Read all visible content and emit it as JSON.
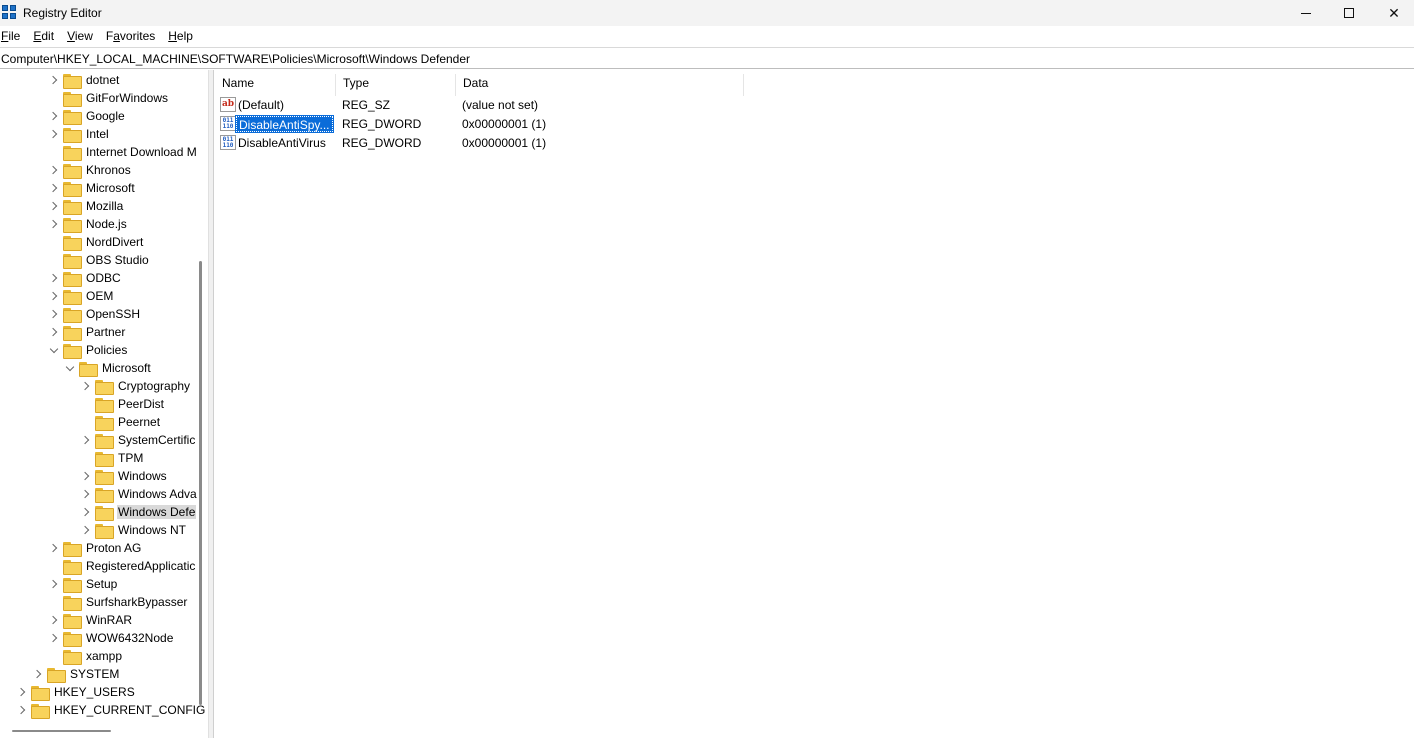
{
  "window": {
    "title": "Registry Editor",
    "controls": {
      "minimize": "",
      "maximize": "",
      "close": "✕"
    }
  },
  "menu": [
    "File",
    "Edit",
    "View",
    "Favorites",
    "Help"
  ],
  "address": "Computer\\HKEY_LOCAL_MACHINE\\SOFTWARE\\Policies\\Microsoft\\Windows Defender",
  "tree": [
    {
      "label": "dotnet",
      "expander": "right",
      "level": 3
    },
    {
      "label": "GitForWindows",
      "expander": "none",
      "level": 3
    },
    {
      "label": "Google",
      "expander": "right",
      "level": 3
    },
    {
      "label": "Intel",
      "expander": "right",
      "level": 3
    },
    {
      "label": "Internet Download M",
      "expander": "none",
      "level": 3
    },
    {
      "label": "Khronos",
      "expander": "right",
      "level": 3
    },
    {
      "label": "Microsoft",
      "expander": "right",
      "level": 3
    },
    {
      "label": "Mozilla",
      "expander": "right",
      "level": 3
    },
    {
      "label": "Node.js",
      "expander": "right",
      "level": 3
    },
    {
      "label": "NordDivert",
      "expander": "none",
      "level": 3
    },
    {
      "label": "OBS Studio",
      "expander": "none",
      "level": 3
    },
    {
      "label": "ODBC",
      "expander": "right",
      "level": 3
    },
    {
      "label": "OEM",
      "expander": "right",
      "level": 3
    },
    {
      "label": "OpenSSH",
      "expander": "right",
      "level": 3
    },
    {
      "label": "Partner",
      "expander": "right",
      "level": 3
    },
    {
      "label": "Policies",
      "expander": "down",
      "level": 3
    },
    {
      "label": "Microsoft",
      "expander": "down",
      "level": 4
    },
    {
      "label": "Cryptography",
      "expander": "right",
      "level": 5
    },
    {
      "label": "PeerDist",
      "expander": "none",
      "level": 5
    },
    {
      "label": "Peernet",
      "expander": "none",
      "level": 5
    },
    {
      "label": "SystemCertific",
      "expander": "right",
      "level": 5
    },
    {
      "label": "TPM",
      "expander": "none",
      "level": 5
    },
    {
      "label": "Windows",
      "expander": "right",
      "level": 5
    },
    {
      "label": "Windows Adva",
      "expander": "right",
      "level": 5
    },
    {
      "label": "Windows Defe",
      "expander": "right",
      "level": 5,
      "selected": true
    },
    {
      "label": "Windows NT",
      "expander": "right",
      "level": 5
    },
    {
      "label": "Proton AG",
      "expander": "right",
      "level": 3
    },
    {
      "label": "RegisteredApplicatic",
      "expander": "none",
      "level": 3
    },
    {
      "label": "Setup",
      "expander": "right",
      "level": 3
    },
    {
      "label": "SurfsharkBypasser",
      "expander": "none",
      "level": 3
    },
    {
      "label": "WinRAR",
      "expander": "right",
      "level": 3
    },
    {
      "label": "WOW6432Node",
      "expander": "right",
      "level": 3
    },
    {
      "label": "xampp",
      "expander": "none",
      "level": 3
    },
    {
      "label": "SYSTEM",
      "expander": "right",
      "level": 2
    },
    {
      "label": "HKEY_USERS",
      "expander": "right",
      "level": 1
    },
    {
      "label": "HKEY_CURRENT_CONFIG",
      "expander": "right",
      "level": 1
    }
  ],
  "list": {
    "columns": [
      "Name",
      "Type",
      "Data"
    ],
    "rows": [
      {
        "icon": "string-value-icon",
        "name": "(Default)",
        "type": "REG_SZ",
        "data": "(value not set)",
        "selected": false
      },
      {
        "icon": "dword-value-icon",
        "name": "DisableAntiSpy...",
        "type": "REG_DWORD",
        "data": "0x00000001 (1)",
        "selected": true
      },
      {
        "icon": "dword-value-icon",
        "name": "DisableAntiVirus",
        "type": "REG_DWORD",
        "data": "0x00000001 (1)",
        "selected": false
      }
    ]
  },
  "colors": {
    "selection": "#0a6cd9",
    "folder": "#f8d35c",
    "tree_selected": "#d9d9d9"
  }
}
